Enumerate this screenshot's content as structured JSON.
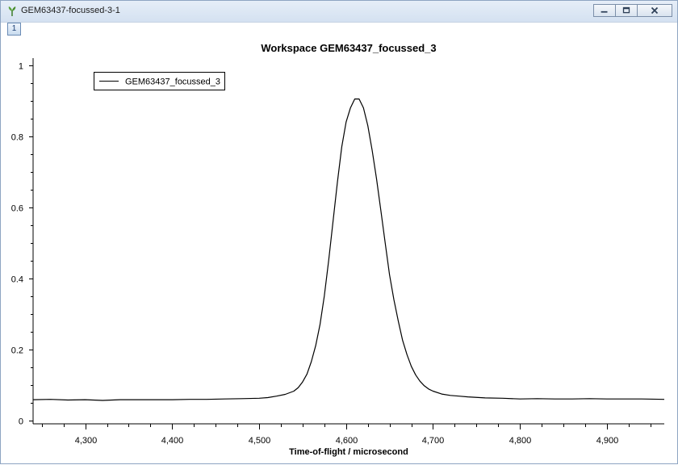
{
  "window": {
    "title": "GEM63437-focussed-3-1",
    "layer_badge": "1",
    "icon": "mantid-plant-icon",
    "buttons": [
      "minimize-icon",
      "restore-icon",
      "close-icon"
    ]
  },
  "chart_data": {
    "type": "line",
    "title": "Workspace GEM63437_focussed_3",
    "xlabel": "Time-of-flight / microsecond",
    "ylabel": "",
    "xlim": [
      4240,
      4966
    ],
    "ylim": [
      -0.01,
      1.02
    ],
    "xticks": [
      4300,
      4400,
      4500,
      4600,
      4700,
      4800,
      4900
    ],
    "xtick_labels": [
      "4,300",
      "4,400",
      "4,500",
      "4,600",
      "4,700",
      "4,800",
      "4,900"
    ],
    "yticks": [
      0,
      0.2,
      0.4,
      0.6,
      0.8,
      1
    ],
    "ytick_labels": [
      "0",
      "0.2",
      "0.4",
      "0.6",
      "0.8",
      "1"
    ],
    "grid": false,
    "legend_position": "top-left",
    "series": [
      {
        "name": "GEM63437_focussed_3",
        "color": "#000000",
        "x": [
          4240,
          4260,
          4280,
          4300,
          4320,
          4340,
          4360,
          4380,
          4400,
          4420,
          4440,
          4460,
          4480,
          4500,
          4510,
          4520,
          4530,
          4540,
          4545,
          4550,
          4555,
          4560,
          4565,
          4570,
          4575,
          4580,
          4585,
          4590,
          4595,
          4600,
          4605,
          4610,
          4615,
          4620,
          4625,
          4630,
          4635,
          4640,
          4645,
          4650,
          4655,
          4660,
          4665,
          4670,
          4675,
          4680,
          4685,
          4690,
          4695,
          4700,
          4710,
          4720,
          4730,
          4740,
          4760,
          4780,
          4800,
          4820,
          4840,
          4860,
          4880,
          4900,
          4920,
          4940,
          4966
        ],
        "y": [
          0.058,
          0.059,
          0.057,
          0.058,
          0.056,
          0.058,
          0.058,
          0.058,
          0.058,
          0.059,
          0.059,
          0.06,
          0.061,
          0.062,
          0.064,
          0.068,
          0.073,
          0.082,
          0.092,
          0.108,
          0.13,
          0.165,
          0.21,
          0.27,
          0.35,
          0.45,
          0.56,
          0.67,
          0.77,
          0.84,
          0.88,
          0.905,
          0.905,
          0.88,
          0.83,
          0.76,
          0.68,
          0.59,
          0.5,
          0.41,
          0.34,
          0.28,
          0.225,
          0.185,
          0.152,
          0.128,
          0.11,
          0.097,
          0.088,
          0.082,
          0.074,
          0.07,
          0.068,
          0.066,
          0.063,
          0.062,
          0.06,
          0.061,
          0.06,
          0.06,
          0.061,
          0.06,
          0.06,
          0.06,
          0.059
        ]
      }
    ]
  }
}
